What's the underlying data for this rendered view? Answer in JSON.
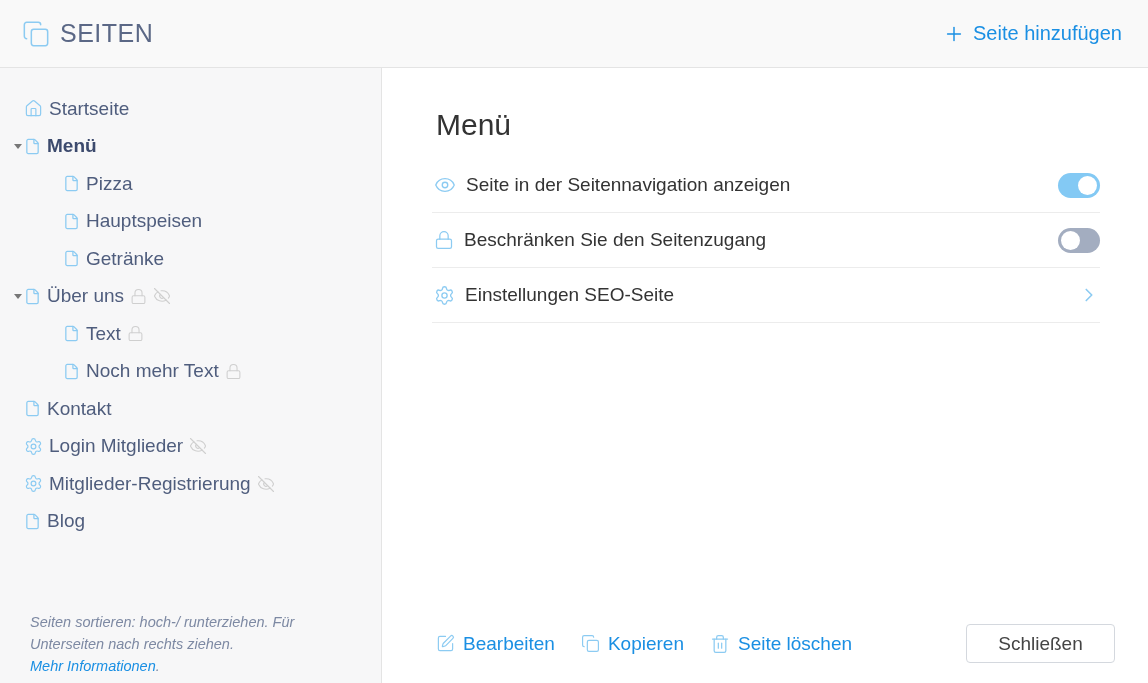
{
  "header": {
    "title": "SEITEN",
    "add_button": "Seite hinzufügen"
  },
  "sidebar": {
    "items": [
      {
        "label": "Startseite",
        "kind": "home",
        "selected": false,
        "locked": false,
        "hidden": false
      },
      {
        "label": "Menü",
        "kind": "page",
        "selected": true,
        "expanded": true,
        "locked": false,
        "hidden": false,
        "children": [
          {
            "label": "Pizza",
            "kind": "page",
            "selected": false,
            "locked": false,
            "hidden": false
          },
          {
            "label": "Hauptspeisen",
            "kind": "page",
            "selected": false,
            "locked": false,
            "hidden": false
          },
          {
            "label": "Getränke",
            "kind": "page",
            "selected": false,
            "locked": false,
            "hidden": false
          }
        ]
      },
      {
        "label": "Über uns",
        "kind": "page",
        "selected": false,
        "expanded": true,
        "locked": true,
        "hidden": true,
        "children": [
          {
            "label": "Text",
            "kind": "page",
            "selected": false,
            "locked": true,
            "hidden": false
          },
          {
            "label": "Noch mehr Text",
            "kind": "page",
            "selected": false,
            "locked": true,
            "hidden": false
          }
        ]
      },
      {
        "label": "Kontakt",
        "kind": "page",
        "selected": false,
        "locked": false,
        "hidden": false
      },
      {
        "label": "Login Mitglieder",
        "kind": "gear",
        "selected": false,
        "locked": false,
        "hidden": true
      },
      {
        "label": "Mitglieder-Registrierung",
        "kind": "gear",
        "selected": false,
        "locked": false,
        "hidden": true
      },
      {
        "label": "Blog",
        "kind": "page",
        "selected": false,
        "locked": false,
        "hidden": false
      }
    ],
    "hint": {
      "text": "Seiten sortieren: hoch-/ runterziehen. Für Unterseiten nach rechts ziehen. ",
      "link": "Mehr Informationen",
      "after": "."
    }
  },
  "detail": {
    "title": "Menü",
    "settings": [
      {
        "kind": "visibility",
        "label": "Seite in der Seitennavigation anzeigen",
        "on": true
      },
      {
        "kind": "access",
        "label": "Beschränken Sie den Seitenzugang",
        "on": false
      },
      {
        "kind": "seo",
        "label": "Einstellungen SEO-Seite"
      }
    ],
    "actions": [
      {
        "kind": "edit",
        "label": "Bearbeiten"
      },
      {
        "kind": "copy",
        "label": "Kopieren"
      },
      {
        "kind": "delete",
        "label": "Seite löschen"
      }
    ],
    "close_button": "Schließen"
  }
}
